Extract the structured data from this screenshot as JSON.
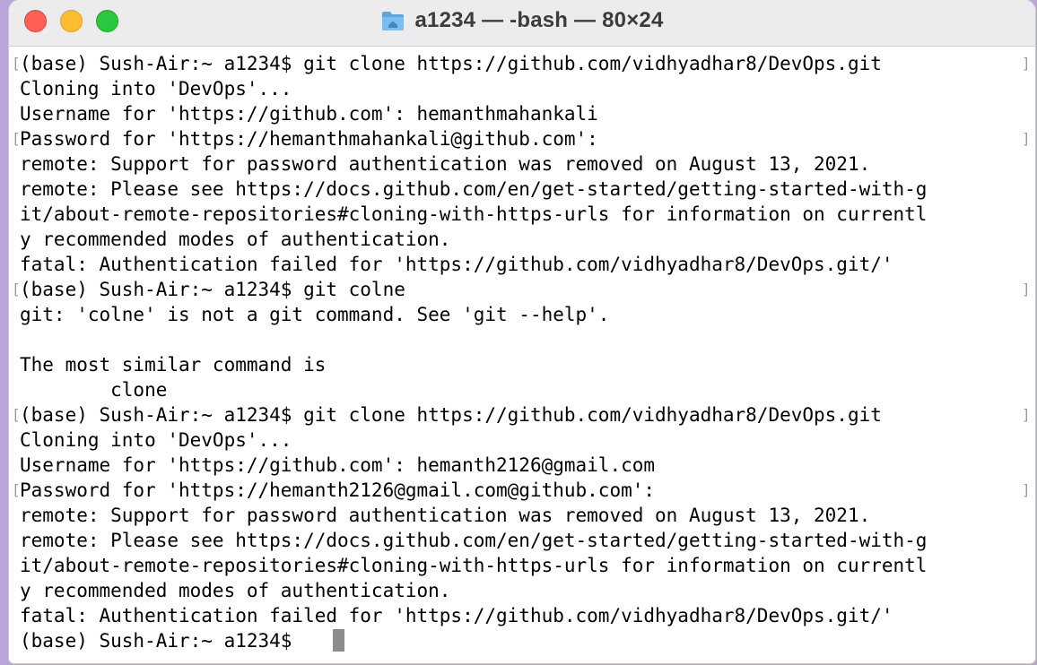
{
  "window": {
    "title": "a1234 — -bash — 80×24",
    "title_icon": "folder-home-icon",
    "accent_colors": {
      "close": "#fe5f57",
      "minimize": "#febc2e",
      "maximize": "#28c840"
    }
  },
  "terminal": {
    "lines": [
      "(base) Sush-Air:~ a1234$ git clone https://github.com/vidhyadhar8/DevOps.git",
      "Cloning into 'DevOps'...",
      "Username for 'https://github.com': hemanthmahankali",
      "Password for 'https://hemanthmahankali@github.com':",
      "remote: Support for password authentication was removed on August 13, 2021.",
      "remote: Please see https://docs.github.com/en/get-started/getting-started-with-g",
      "it/about-remote-repositories#cloning-with-https-urls for information on currentl",
      "y recommended modes of authentication.",
      "fatal: Authentication failed for 'https://github.com/vidhyadhar8/DevOps.git/'",
      "(base) Sush-Air:~ a1234$ git colne",
      "git: 'colne' is not a git command. See 'git --help'.",
      "",
      "The most similar command is",
      "        clone",
      "(base) Sush-Air:~ a1234$ git clone https://github.com/vidhyadhar8/DevOps.git",
      "Cloning into 'DevOps'...",
      "Username for 'https://github.com': hemanth2126@gmail.com",
      "Password for 'https://hemanth2126@gmail.com@github.com':",
      "remote: Support for password authentication was removed on August 13, 2021.",
      "remote: Please see https://docs.github.com/en/get-started/getting-started-with-g",
      "it/about-remote-repositories#cloning-with-https-urls for information on currentl",
      "y recommended modes of authentication.",
      "fatal: Authentication failed for 'https://github.com/vidhyadhar8/DevOps.git/'",
      "(base) Sush-Air:~ a1234$ "
    ],
    "bracket_marked_lines": [
      0,
      3,
      9,
      14,
      17
    ],
    "marker_left": "[",
    "marker_right": "]"
  }
}
